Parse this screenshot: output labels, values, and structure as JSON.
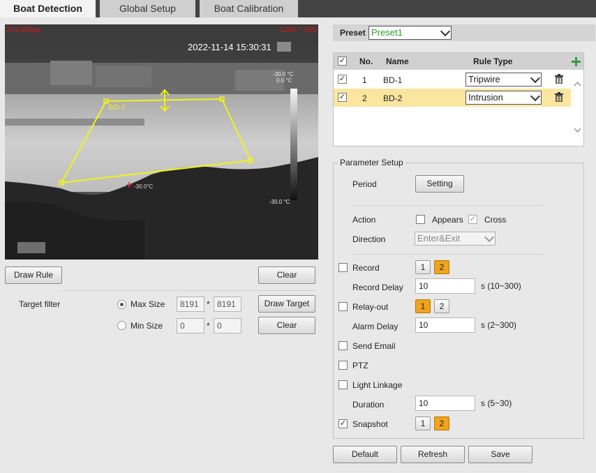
{
  "tabs": [
    "Boat Detection",
    "Global Setup",
    "Boat Calibration"
  ],
  "video": {
    "bitrate": "2010Kbps",
    "resolution": "1280 * 960",
    "timestamp": "2022-11-14 15:30:31",
    "rule_label": "BD-1",
    "temp_top_1": "-30.0 °C",
    "temp_top_2": "0.0 °C",
    "temp_bottom": "-30.0 °C",
    "spot_temp": "-30.0°C"
  },
  "left": {
    "draw_rule": "Draw Rule",
    "clear": "Clear",
    "target_filter": "Target filter",
    "max_size": "Max Size",
    "max_w": "8191",
    "max_h": "8191",
    "min_size": "Min Size",
    "min_w": "0",
    "min_h": "0",
    "times": "*",
    "draw_target": "Draw Target",
    "clear2": "Clear"
  },
  "preset": {
    "label": "Preset",
    "value": "Preset1"
  },
  "rules_table": {
    "headers": [
      "No.",
      "Name",
      "Rule Type"
    ],
    "rows": [
      {
        "no": "1",
        "name": "BD-1",
        "type": "Tripwire",
        "checked": true
      },
      {
        "no": "2",
        "name": "BD-2",
        "type": "Intrusion",
        "checked": true
      }
    ]
  },
  "params": {
    "legend": "Parameter Setup",
    "period": "Period",
    "setting": "Setting",
    "action": "Action",
    "appears": "Appears",
    "cross": "Cross",
    "direction": "Direction",
    "direction_value": "Enter&Exit",
    "record": "Record",
    "record_delay": "Record Delay",
    "record_delay_value": "10",
    "record_delay_range": "s (10~300)",
    "relay_out": "Relay-out",
    "alarm_delay": "Alarm Delay",
    "alarm_delay_value": "10",
    "alarm_delay_range": "s (2~300)",
    "send_email": "Send Email",
    "ptz": "PTZ",
    "light_linkage": "Light Linkage",
    "duration": "Duration",
    "duration_value": "10",
    "duration_range": "s (5~30)",
    "snapshot": "Snapshot",
    "one": "1",
    "two": "2"
  },
  "footer": {
    "default": "Default",
    "refresh": "Refresh",
    "save": "Save"
  },
  "colors": {
    "accent": "#f0a41e",
    "selected_row": "#fbe6a0",
    "rule_line": "#f2f21a",
    "osd_red": "#d41b1b"
  }
}
